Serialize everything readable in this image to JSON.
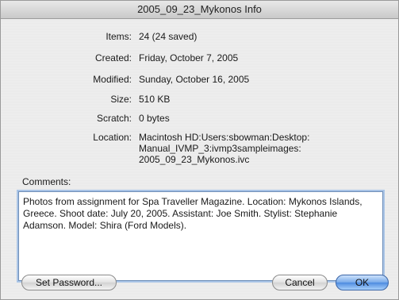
{
  "window": {
    "title": "2005_09_23_Mykonos Info"
  },
  "info": {
    "items_label": "Items:",
    "items_value": "24 (24 saved)",
    "created_label": "Created:",
    "created_value": "Friday, October 7, 2005",
    "modified_label": "Modified:",
    "modified_value": "Sunday, October 16, 2005",
    "size_label": "Size:",
    "size_value": "510 KB",
    "scratch_label": "Scratch:",
    "scratch_value": "0 bytes",
    "location_label": "Location:",
    "location_line1": "Macintosh HD:Users:sbowman:Desktop:",
    "location_line2": "Manual_IVMP_3:ivmp3sampleimages:",
    "location_line3": "2005_09_23_Mykonos.ivc"
  },
  "comments": {
    "label": "Comments:",
    "value": "Photos from assignment for Spa Traveller Magazine. Location: Mykonos Islands, Greece. Shoot date: July 20, 2005. Assistant: Joe Smith. Stylist: Stephanie Adamson. Model: Shira (Ford Models)."
  },
  "buttons": {
    "set_password": "Set Password...",
    "cancel": "Cancel",
    "ok": "OK"
  }
}
